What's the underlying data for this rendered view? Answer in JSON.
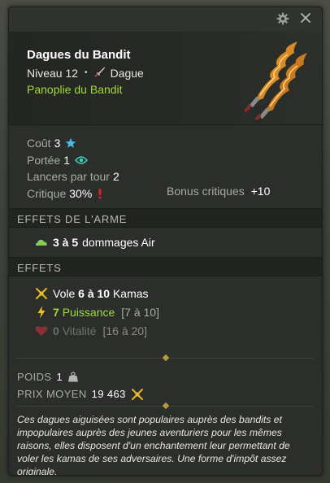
{
  "window": {
    "settings_icon": "gear-icon",
    "close_icon": "close-icon"
  },
  "item": {
    "name": "Dagues du Bandit",
    "level_label": "Niveau 12",
    "separator": "•",
    "type_label": "Dague",
    "set_name": "Panoplie du Bandit"
  },
  "stats": {
    "cost_label": "Coût",
    "cost_value": "3",
    "range_label": "Portée",
    "range_value": "1",
    "casts_label": "Lancers par tour",
    "casts_value": "2",
    "crit_label": "Critique",
    "crit_value": "30%",
    "crit_bonus_label": "Bonus critiques",
    "crit_bonus_value": "+10"
  },
  "weapon_effects": {
    "header": "EFFETS DE L'ARME",
    "damage_value": "3 à 5",
    "damage_text": "dommages Air"
  },
  "effects": {
    "header": "EFFETS",
    "items": [
      {
        "label": "Vole",
        "value": "6 à 10",
        "suffix": "Kamas",
        "range": ""
      },
      {
        "label": "Puissance",
        "value": "7",
        "suffix": "",
        "range": "[7 à 10]"
      },
      {
        "label": "Vitalité",
        "value": "0",
        "suffix": "",
        "range": "[16 à 20]"
      }
    ]
  },
  "misc": {
    "weight_label": "POIDS",
    "weight_value": "1",
    "price_label": "PRIX MOYEN",
    "price_value": "19 463"
  },
  "description": "Ces dagues aiguisées sont populaires auprès des bandits et impopulaires auprès des jeunes aventuriers pour les mêmes raisons, elles disposent d'un enchantement leur permettant de voler les kamas de ses adversaires. Une forme d'impôt assez originale.",
  "colors": {
    "set_green": "#a3d93a",
    "ap_star_blue": "#4fb8e8",
    "range_eye_teal": "#3fcfb5",
    "crit_red": "#e02020",
    "kamas_gold": "#e8b826"
  }
}
